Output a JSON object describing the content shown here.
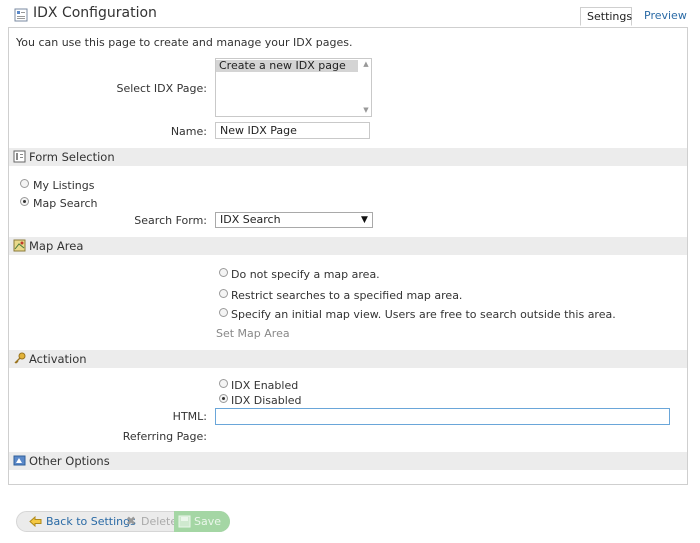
{
  "header": {
    "title": "IDX Configuration",
    "tabs": [
      {
        "label": "Settings"
      },
      {
        "label": "Preview"
      }
    ]
  },
  "intro": "You can use this page to create and manage your IDX pages.",
  "idx_page": {
    "select_label": "Select IDX Page:",
    "options": [
      "Create a new IDX page"
    ],
    "name_label": "Name:",
    "name_value": "New IDX Page"
  },
  "form_selection": {
    "title": "Form Selection",
    "radios": [
      {
        "label": "My Listings",
        "checked": false
      },
      {
        "label": "Map Search",
        "checked": true
      }
    ],
    "search_form_label": "Search Form:",
    "search_form_value": "IDX Search"
  },
  "map_area": {
    "title": "Map Area",
    "radios": [
      {
        "label": "Do not specify a map area.",
        "checked": false
      },
      {
        "label": "Restrict searches to a specified map area.",
        "checked": false
      },
      {
        "label": "Specify an initial map view. Users are free to search outside this area.",
        "checked": false
      }
    ],
    "set_map_area": "Set Map Area"
  },
  "activation": {
    "title": "Activation",
    "radios": [
      {
        "label": "IDX Enabled",
        "checked": false
      },
      {
        "label": "IDX Disabled",
        "checked": true
      }
    ],
    "html_label": "HTML:",
    "html_value": "",
    "referring_label": "Referring Page:"
  },
  "other_options": {
    "title": "Other Options"
  },
  "buttons": {
    "back": "Back to Settings",
    "delete": "Delete",
    "save": "Save"
  }
}
